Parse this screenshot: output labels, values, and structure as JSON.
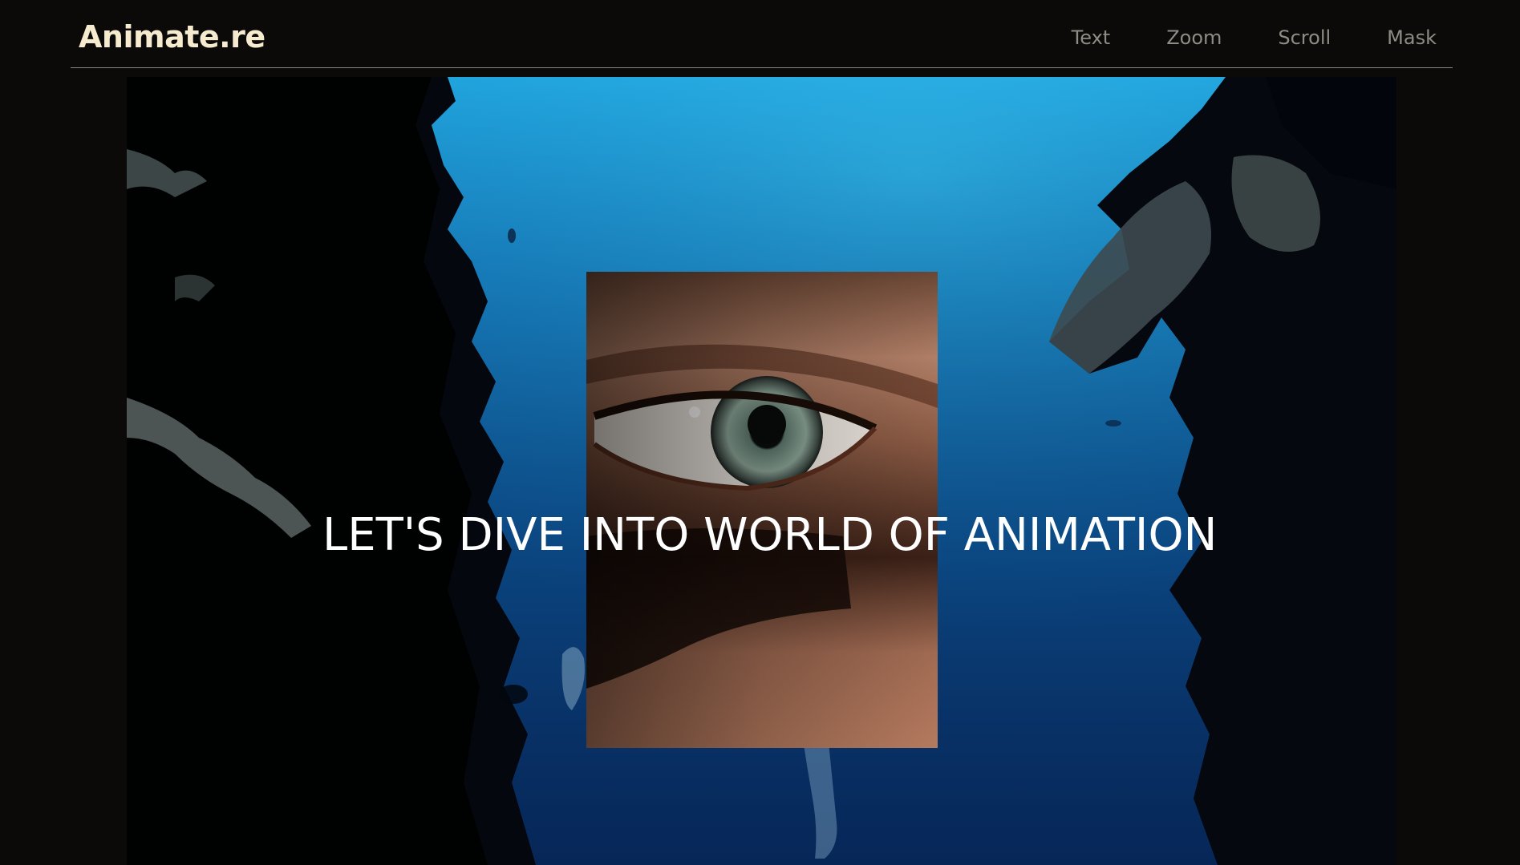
{
  "header": {
    "logo": "Animate.re",
    "nav": [
      {
        "label": "Text"
      },
      {
        "label": "Zoom"
      },
      {
        "label": "Scroll"
      },
      {
        "label": "Mask"
      }
    ]
  },
  "hero": {
    "headline": "LET'S DIVE INTO WORLD OF ANIMATION",
    "background_image": "underwater reef canyon with diver",
    "inset_image": "close-up of a human eye"
  },
  "colors": {
    "page_background": "#0b0a09",
    "logo": "#f6ebcf",
    "nav_text": "#8f8b85",
    "divider": "#8a8680",
    "headline": "#ffffff",
    "water_top": "#1fa4dc",
    "water_bottom": "#0a3f8a"
  }
}
